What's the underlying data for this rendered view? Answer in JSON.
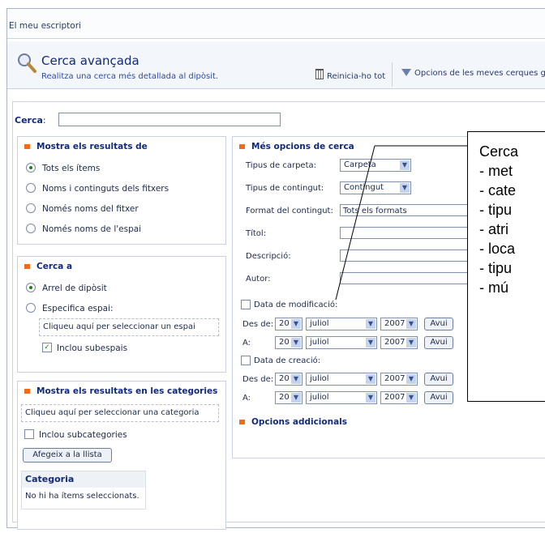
{
  "breadcrumb": "El meu escriptori",
  "header": {
    "title": "Cerca avançada",
    "subtitle": "Realitza una cerca més detallada al dipòsit.",
    "reset_label": "Reinicia-ho tot",
    "my_searches_label": "Opcions de les meves cerques gu"
  },
  "search": {
    "label": "Cerca",
    "colon": ":",
    "value": ""
  },
  "show_results": {
    "title": "Mostra els resultats de",
    "options": [
      "Tots els ítems",
      "Noms i continguts dels fitxers",
      "Només noms del fitxer",
      "Només noms de l'espai"
    ],
    "selected": 0
  },
  "search_in": {
    "title": "Cerca a",
    "options": [
      "Arrel de dipòsit",
      "Especifica espai:"
    ],
    "selected": 0,
    "select_space": "Cliqueu aquí per seleccionar un espai",
    "include_subspaces": "Inclou subespais",
    "include_subspaces_checked": true
  },
  "categories": {
    "title": "Mostra els resultats en les categories",
    "select_category": "Cliqueu aquí per seleccionar una categoria",
    "include_subcategories": "Inclou subcategories",
    "include_subcategories_checked": false,
    "add_button": "Afegeix a la llista",
    "column_header": "Categoria",
    "empty_text": "No hi ha ítems seleccionats."
  },
  "more_options": {
    "title": "Més opcions de cerca",
    "folder_type_label": "Tipus de carpeta:",
    "folder_type_value": "Carpeta",
    "content_type_label": "Tipus de contingut:",
    "content_type_value": "Contingut",
    "format_label": "Format del contingut:",
    "format_value": "Tots els formats",
    "title_label": "Títol:",
    "description_label": "Descripció:",
    "author_label": "Autor:",
    "modified_label": "Data de modificació:",
    "created_label": "Data de creació:",
    "from_label": "Des de:",
    "to_label": "A:",
    "day": "20",
    "month": "juliol",
    "year": "2007",
    "today_button": "Avui",
    "additional_options": "Opcions addicionals"
  },
  "callout": {
    "lines": [
      "Cerca",
      "- met",
      "- cate",
      "- tipu",
      "- atri",
      "- loca",
      "- tipu",
      "- mú"
    ]
  },
  "colors": {
    "accent": "#f26b1a",
    "title": "#112a7a",
    "link": "#2f4ca0",
    "check": "#1a7f1a"
  }
}
